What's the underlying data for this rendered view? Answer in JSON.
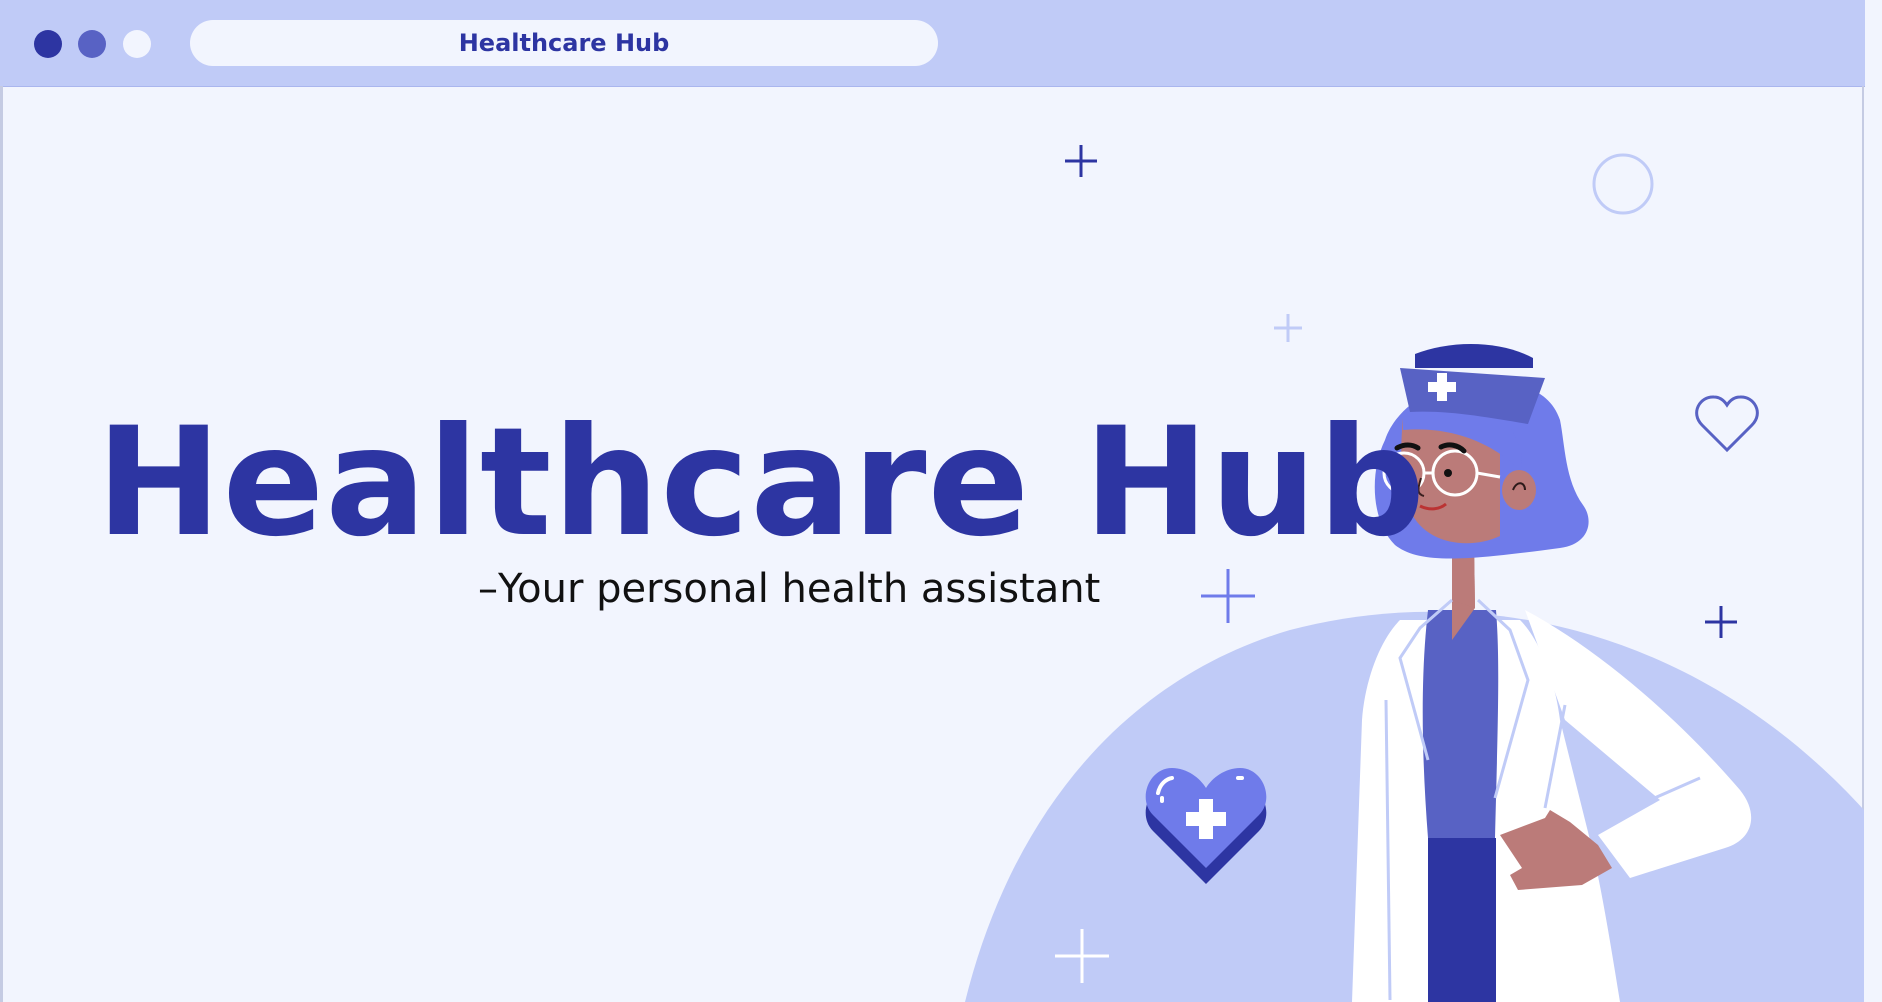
{
  "browser": {
    "address_title": "Healthcare Hub",
    "window_dots": [
      "close-dot",
      "minimize-dot",
      "maximize-dot"
    ]
  },
  "hero": {
    "title": "Healthcare Hub",
    "subtitle": "–Your personal health assistant"
  },
  "colors": {
    "primary": "#2d35a2",
    "secondary": "#5862c4",
    "accent_light": "#c0cbf7",
    "background": "#f2f5fe",
    "hair": "#6f7bea",
    "skin": "#bb7b79"
  },
  "icons": [
    "plus-sign-icon",
    "circle-outline-icon",
    "heart-outline-icon",
    "heart-medical-icon",
    "nurse-cap-cross-icon"
  ]
}
